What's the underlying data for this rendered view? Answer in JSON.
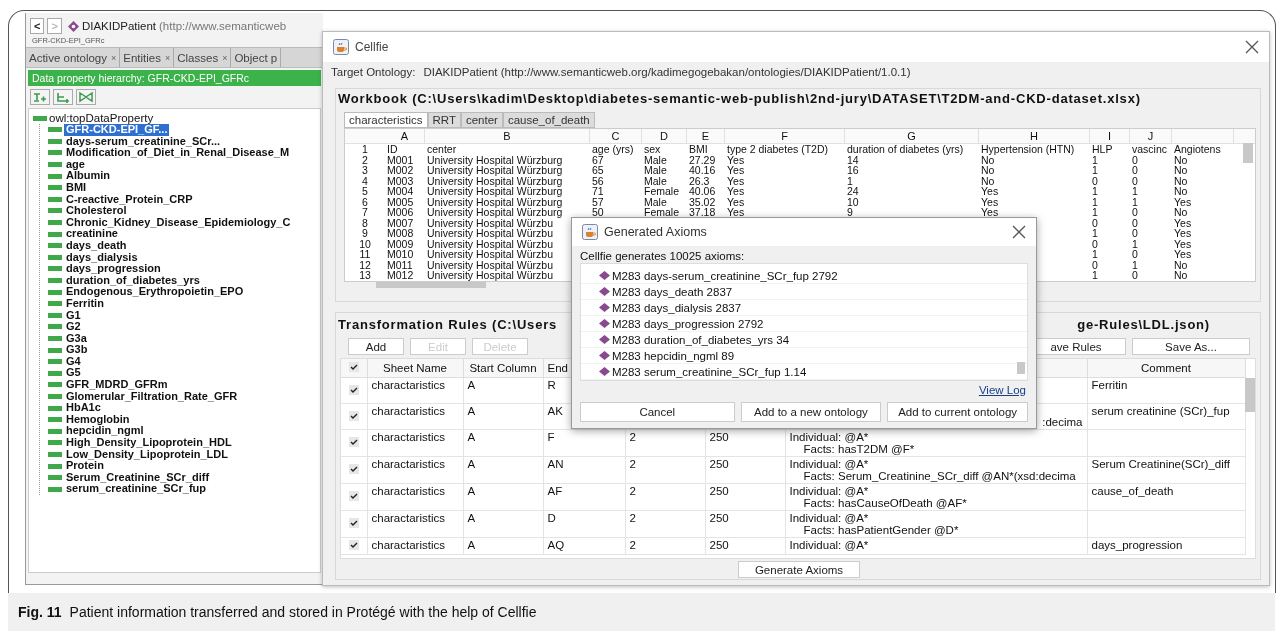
{
  "protege": {
    "nav_buttons": [
      {
        "label": "<",
        "disabled": false
      },
      {
        "label": ">",
        "disabled": true
      }
    ],
    "ontology_name": "DIAKIDPatient",
    "ontology_iri": "(http://www.semanticweb",
    "breadcrumb": "GFR-CKD-EPI_GFRc",
    "tabs": [
      {
        "label": "Active ontology",
        "close_mark": "×",
        "selected": false
      },
      {
        "label": "Entities",
        "close_mark": "×",
        "selected": false
      },
      {
        "label": "Classes",
        "close_mark": "×",
        "selected": false
      },
      {
        "label": "Object p",
        "selected": false
      }
    ],
    "panel_title": "Data property hierarchy: GFR-CKD-EPI_GFRc",
    "tree": {
      "label": "owl:topDataProperty",
      "children": [
        {
          "label": "GFR-CKD-EPI_GF...",
          "selected": true
        },
        {
          "label": "days-serum_creatinine_SCr...",
          "selected": false
        },
        {
          "label": "Modification_of_Diet_in_Renal_Disease_M",
          "selected": false
        },
        {
          "label": "age",
          "selected": false
        },
        {
          "label": "Albumin",
          "selected": false
        },
        {
          "label": "BMI",
          "selected": false
        },
        {
          "label": "C-reactive_Protein_CRP",
          "selected": false
        },
        {
          "label": "Cholesterol",
          "selected": false
        },
        {
          "label": "Chronic_Kidney_Disease_Epidemiology_C",
          "selected": false
        },
        {
          "label": "creatinine",
          "selected": false
        },
        {
          "label": "days_death",
          "selected": false
        },
        {
          "label": "days_dialysis",
          "selected": false
        },
        {
          "label": "days_progression",
          "selected": false
        },
        {
          "label": "duration_of_diabetes_yrs",
          "selected": false
        },
        {
          "label": "Endogenous_Erythropoietin_EPO",
          "selected": false
        },
        {
          "label": "Ferritin",
          "selected": false
        },
        {
          "label": "G1",
          "selected": false
        },
        {
          "label": "G2",
          "selected": false
        },
        {
          "label": "G3a",
          "selected": false
        },
        {
          "label": "G3b",
          "selected": false
        },
        {
          "label": "G4",
          "selected": false
        },
        {
          "label": "G5",
          "selected": false
        },
        {
          "label": "GFR_MDRD_GFRm",
          "selected": false
        },
        {
          "label": "Glomerular_Filtration_Rate_GFR",
          "selected": false
        },
        {
          "label": "HbA1c",
          "selected": false
        },
        {
          "label": "Hemoglobin",
          "selected": false
        },
        {
          "label": "hepcidin_ngml",
          "selected": false
        },
        {
          "label": "High_Density_Lipoprotein_HDL",
          "selected": false
        },
        {
          "label": "Low_Density_Lipoprotein_LDL",
          "selected": false
        },
        {
          "label": "Protein",
          "selected": false
        },
        {
          "label": "Serum_Creatinine_SCr_diff",
          "selected": false
        },
        {
          "label": "serum_creatinine_SCr_fup",
          "selected": false
        }
      ]
    }
  },
  "cellfie": {
    "title": "Cellfie",
    "target_label": "Target Ontology:",
    "target_value": "DIAKIDPatient (http://www.semanticweb.org/kadimegogebakan/ontologies/DIAKIDPatient/1.0.1)",
    "workbook_title": "Workbook (C:\\Users\\kadim\\Desktop\\diabetes-semantic-web-publish\\2nd-jury\\DATASET\\T2DM-and-CKD-dataset.xlsx)",
    "sheets": [
      {
        "label": "characteristics",
        "selected": true
      },
      {
        "label": "RRT",
        "selected": false
      },
      {
        "label": "center",
        "selected": false
      },
      {
        "label": "cause_of_death",
        "selected": false
      }
    ],
    "sheet_table": {
      "column_letters": [
        "A",
        "B",
        "C",
        "D",
        "E",
        "F",
        "G",
        "H",
        "I",
        "J"
      ],
      "rows": [
        {
          "row": "1",
          "cells": [
            "ID",
            "center",
            "age (yrs)",
            "sex",
            "BMI",
            "type 2 diabetes (T2D)",
            "duration of diabetes (yrs)",
            "Hypertension (HTN)",
            "HLP",
            "vascinc",
            "Angiotens"
          ]
        },
        {
          "row": "2",
          "cells": [
            "M001",
            "University Hospital Würzburg",
            "67",
            "Male",
            "27.29",
            "Yes",
            "14",
            "No",
            "1",
            "0",
            "No"
          ]
        },
        {
          "row": "3",
          "cells": [
            "M002",
            "University Hospital Würzburg",
            "65",
            "Male",
            "40.16",
            "Yes",
            "16",
            "No",
            "1",
            "0",
            "No"
          ]
        },
        {
          "row": "4",
          "cells": [
            "M003",
            "University Hospital Würzburg",
            "56",
            "Male",
            "26.3",
            "Yes",
            "1",
            "No",
            "0",
            "0",
            "No"
          ]
        },
        {
          "row": "5",
          "cells": [
            "M004",
            "University Hospital Würzburg",
            "71",
            "Female",
            "40.06",
            "Yes",
            "24",
            "Yes",
            "1",
            "1",
            "No"
          ]
        },
        {
          "row": "6",
          "cells": [
            "M005",
            "University Hospital Würzburg",
            "57",
            "Male",
            "35.02",
            "Yes",
            "10",
            "Yes",
            "1",
            "1",
            "Yes"
          ]
        },
        {
          "row": "7",
          "cells": [
            "M006",
            "University Hospital Würzburg",
            "50",
            "Female",
            "37.18",
            "Yes",
            "9",
            "Yes",
            "1",
            "0",
            "No"
          ]
        },
        {
          "row": "8",
          "cells": [
            "M007",
            "University Hospital Würzbu"
          ],
          "right_cells": [
            "0",
            "0",
            "Yes"
          ]
        },
        {
          "row": "9",
          "cells": [
            "M008",
            "University Hospital Würzbu"
          ],
          "right_cells": [
            "1",
            "0",
            "Yes"
          ]
        },
        {
          "row": "10",
          "cells": [
            "M009",
            "University Hospital Würzbu"
          ],
          "right_cells": [
            "0",
            "1",
            "Yes"
          ]
        },
        {
          "row": "11",
          "cells": [
            "M010",
            "University Hospital Würzbu"
          ],
          "right_cells": [
            "1",
            "0",
            "Yes"
          ]
        },
        {
          "row": "12",
          "cells": [
            "M011",
            "University Hospital Würzbu"
          ],
          "right_cells": [
            "0",
            "1",
            "No"
          ]
        },
        {
          "row": "13",
          "cells": [
            "M012",
            "University Hospital Würzbu"
          ],
          "right_cells": [
            "1",
            "0",
            "No"
          ]
        }
      ]
    },
    "rules": {
      "heading_start": "Transformation Rules (C:\\Users",
      "heading_end": "ge-Rules\\LDL.json)",
      "buttons": [
        {
          "label": "Add",
          "disabled": false
        },
        {
          "label": "Edit",
          "disabled": true
        },
        {
          "label": "Delete",
          "disabled": true
        }
      ],
      "save_buttons": [
        {
          "label": "ave Rules",
          "disabled": false
        },
        {
          "label": "Save As...",
          "disabled": false
        }
      ],
      "header": {
        "checked": true,
        "sheet": "Sheet Name",
        "start_column": "Start Column",
        "end_column": "End",
        "comment": "Comment"
      },
      "rows": [
        {
          "checked": true,
          "sheet": "charactaristics",
          "start_column": "A",
          "end_column": "R",
          "comment": "Ferritin"
        },
        {
          "checked": true,
          "sheet": "charactaristics",
          "start_column": "A",
          "end_column": "AK",
          "rule_tail": ":decima",
          "comment": "serum creatinine (SCr)_fup"
        },
        {
          "checked": true,
          "sheet": "charactaristics",
          "start_column": "A",
          "end_column": "F",
          "start_row": "2",
          "end_row": "250",
          "rule": [
            "Individual: @A*",
            "Facts: hasT2DM @F*"
          ]
        },
        {
          "checked": true,
          "sheet": "charactaristics",
          "start_column": "A",
          "end_column": "AN",
          "start_row": "2",
          "end_row": "250",
          "rule": [
            "Individual: @A*",
            "Facts: Serum_Creatinine_SCr_diff @AN*(xsd:decima"
          ],
          "comment": "Serum Creatinine(SCr)_diff"
        },
        {
          "checked": true,
          "sheet": "charactaristics",
          "start_column": "A",
          "end_column": "AF",
          "start_row": "2",
          "end_row": "250",
          "rule": [
            "Individual: @A*",
            "Facts: hasCauseOfDeath @AF*"
          ],
          "comment": "cause_of_death"
        },
        {
          "checked": true,
          "sheet": "charactaristics",
          "start_column": "A",
          "end_column": "D",
          "start_row": "2",
          "end_row": "250",
          "rule": [
            "Individual: @A*",
            "Facts: hasPatientGender @D*"
          ]
        },
        {
          "checked": true,
          "sheet": "charactaristics",
          "start_column": "A",
          "end_column": "AQ",
          "start_row": "2",
          "end_row": "250",
          "rule": [
            "Individual: @A*"
          ],
          "comment": "days_progression"
        }
      ],
      "generate_button": "Generate Axioms"
    }
  },
  "dialog": {
    "title": "Generated Axioms",
    "summary": "Cellfie generates 10025 axioms:",
    "items": [
      "M283 days-serum_creatinine_SCr_fup 2792",
      "M283 days_death 2837",
      "M283 days_dialysis 2837",
      "M283 days_progression 2792",
      "M283 duration_of_diabetes_yrs 34",
      "M283 hepcidin_ngml 89",
      "M283 serum_creatinine_SCr_fup 1.14"
    ],
    "view_log": "View Log",
    "buttons": [
      "Cancel",
      "Add to a new ontology",
      "Add to current ontology"
    ]
  },
  "caption": {
    "label": "Fig. 11",
    "text": "Patient information transferred and stored in Protégé with the help of Cellfie"
  }
}
